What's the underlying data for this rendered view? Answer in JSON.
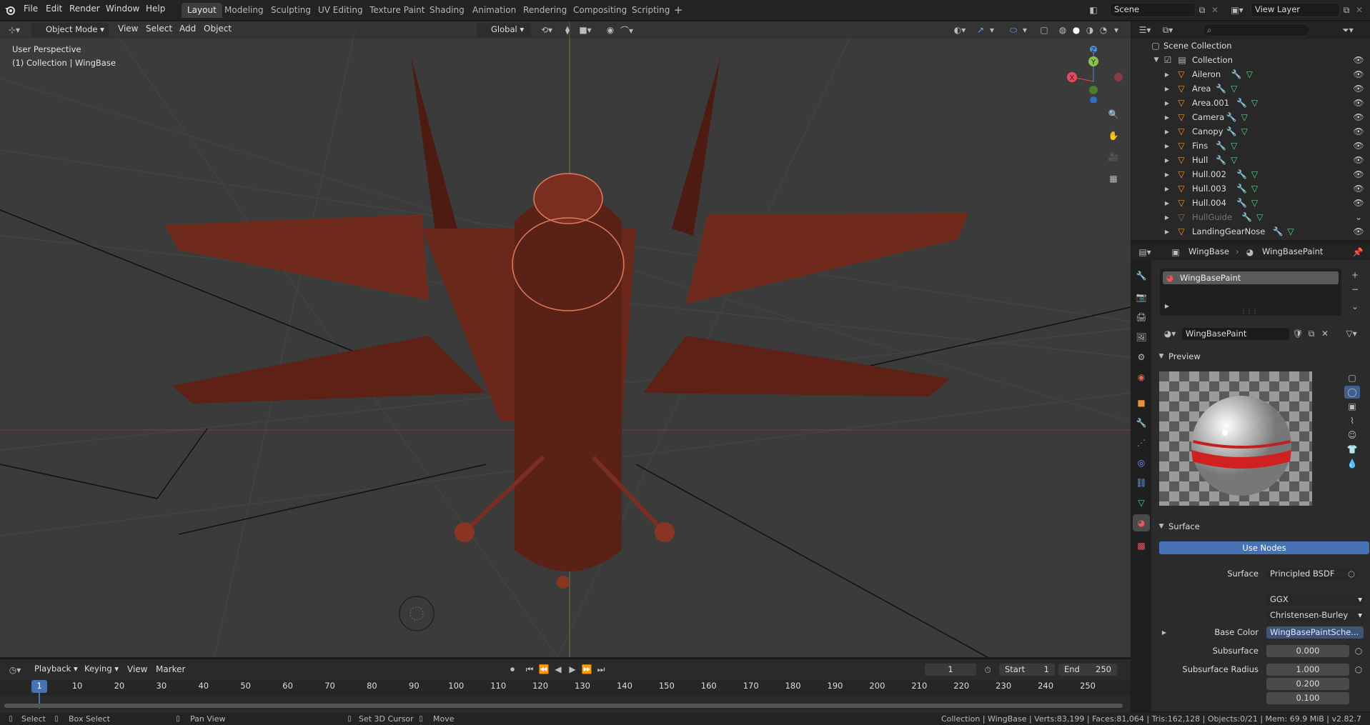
{
  "app": {
    "accent": "#4772b3"
  },
  "menu": {
    "file": "File",
    "edit": "Edit",
    "render": "Render",
    "window": "Window",
    "help": "Help"
  },
  "workspaces": [
    "Layout",
    "Modeling",
    "Sculpting",
    "UV Editing",
    "Texture Paint",
    "Shading",
    "Animation",
    "Rendering",
    "Compositing",
    "Scripting"
  ],
  "scene": {
    "name": "Scene",
    "view_layer": "View Layer"
  },
  "viewport": {
    "mode": "Object Mode",
    "view": "View",
    "select": "Select",
    "add": "Add",
    "object": "Object",
    "transform_orientation": "Global",
    "perspective_label": "User Perspective",
    "collection_label": "(1) Collection | WingBase",
    "gizmo": {
      "x": "X",
      "y": "Y",
      "z": "Z"
    }
  },
  "outliner": {
    "search_placeholder": "",
    "root": "Scene Collection",
    "collection": "Collection",
    "items": [
      "Aileron",
      "Area",
      "Area.001",
      "Camera",
      "Canopy",
      "Fins",
      "Hull",
      "Hull.002",
      "Hull.003",
      "Hull.004",
      "HullGuide",
      "LandingGearNose"
    ]
  },
  "properties": {
    "object_name": "WingBase",
    "material_name": "WingBasePaint",
    "slot_name": "WingBasePaint",
    "material_field": "WingBasePaint",
    "preview_title": "Preview",
    "surface_title": "Surface",
    "use_nodes": "Use Nodes",
    "surface_label": "Surface",
    "surface_value": "Principled BSDF",
    "distribution": "GGX",
    "subsurface_method": "Christensen-Burley",
    "base_color_label": "Base Color",
    "base_color_value": "WingBasePaintSche...",
    "subsurface_label": "Subsurface",
    "subsurface_value": "0.000",
    "subsurface_radius_label": "Subsurface Radius",
    "radius_values": [
      "1.000",
      "0.200",
      "0.100"
    ]
  },
  "timeline": {
    "playback": "Playback",
    "keying": "Keying",
    "view": "View",
    "marker": "Marker",
    "current_frame": "1",
    "start_label": "Start",
    "start_value": "1",
    "end_label": "End",
    "end_value": "250",
    "ticks": [
      "1",
      "10",
      "20",
      "30",
      "40",
      "50",
      "60",
      "70",
      "80",
      "90",
      "100",
      "110",
      "120",
      "130",
      "140",
      "150",
      "160",
      "170",
      "180",
      "190",
      "200",
      "210",
      "220",
      "230",
      "240",
      "250"
    ]
  },
  "status": {
    "select": "Select",
    "box_select": "Box Select",
    "pan_view": "Pan View",
    "set_cursor": "Set 3D Cursor",
    "move": "Move",
    "info": "Collection | WingBase | Verts:83,199 | Faces:81,064 | Tris:162,128 | Objects:0/21 | Mem: 69.9 MiB | v2.82.7"
  }
}
